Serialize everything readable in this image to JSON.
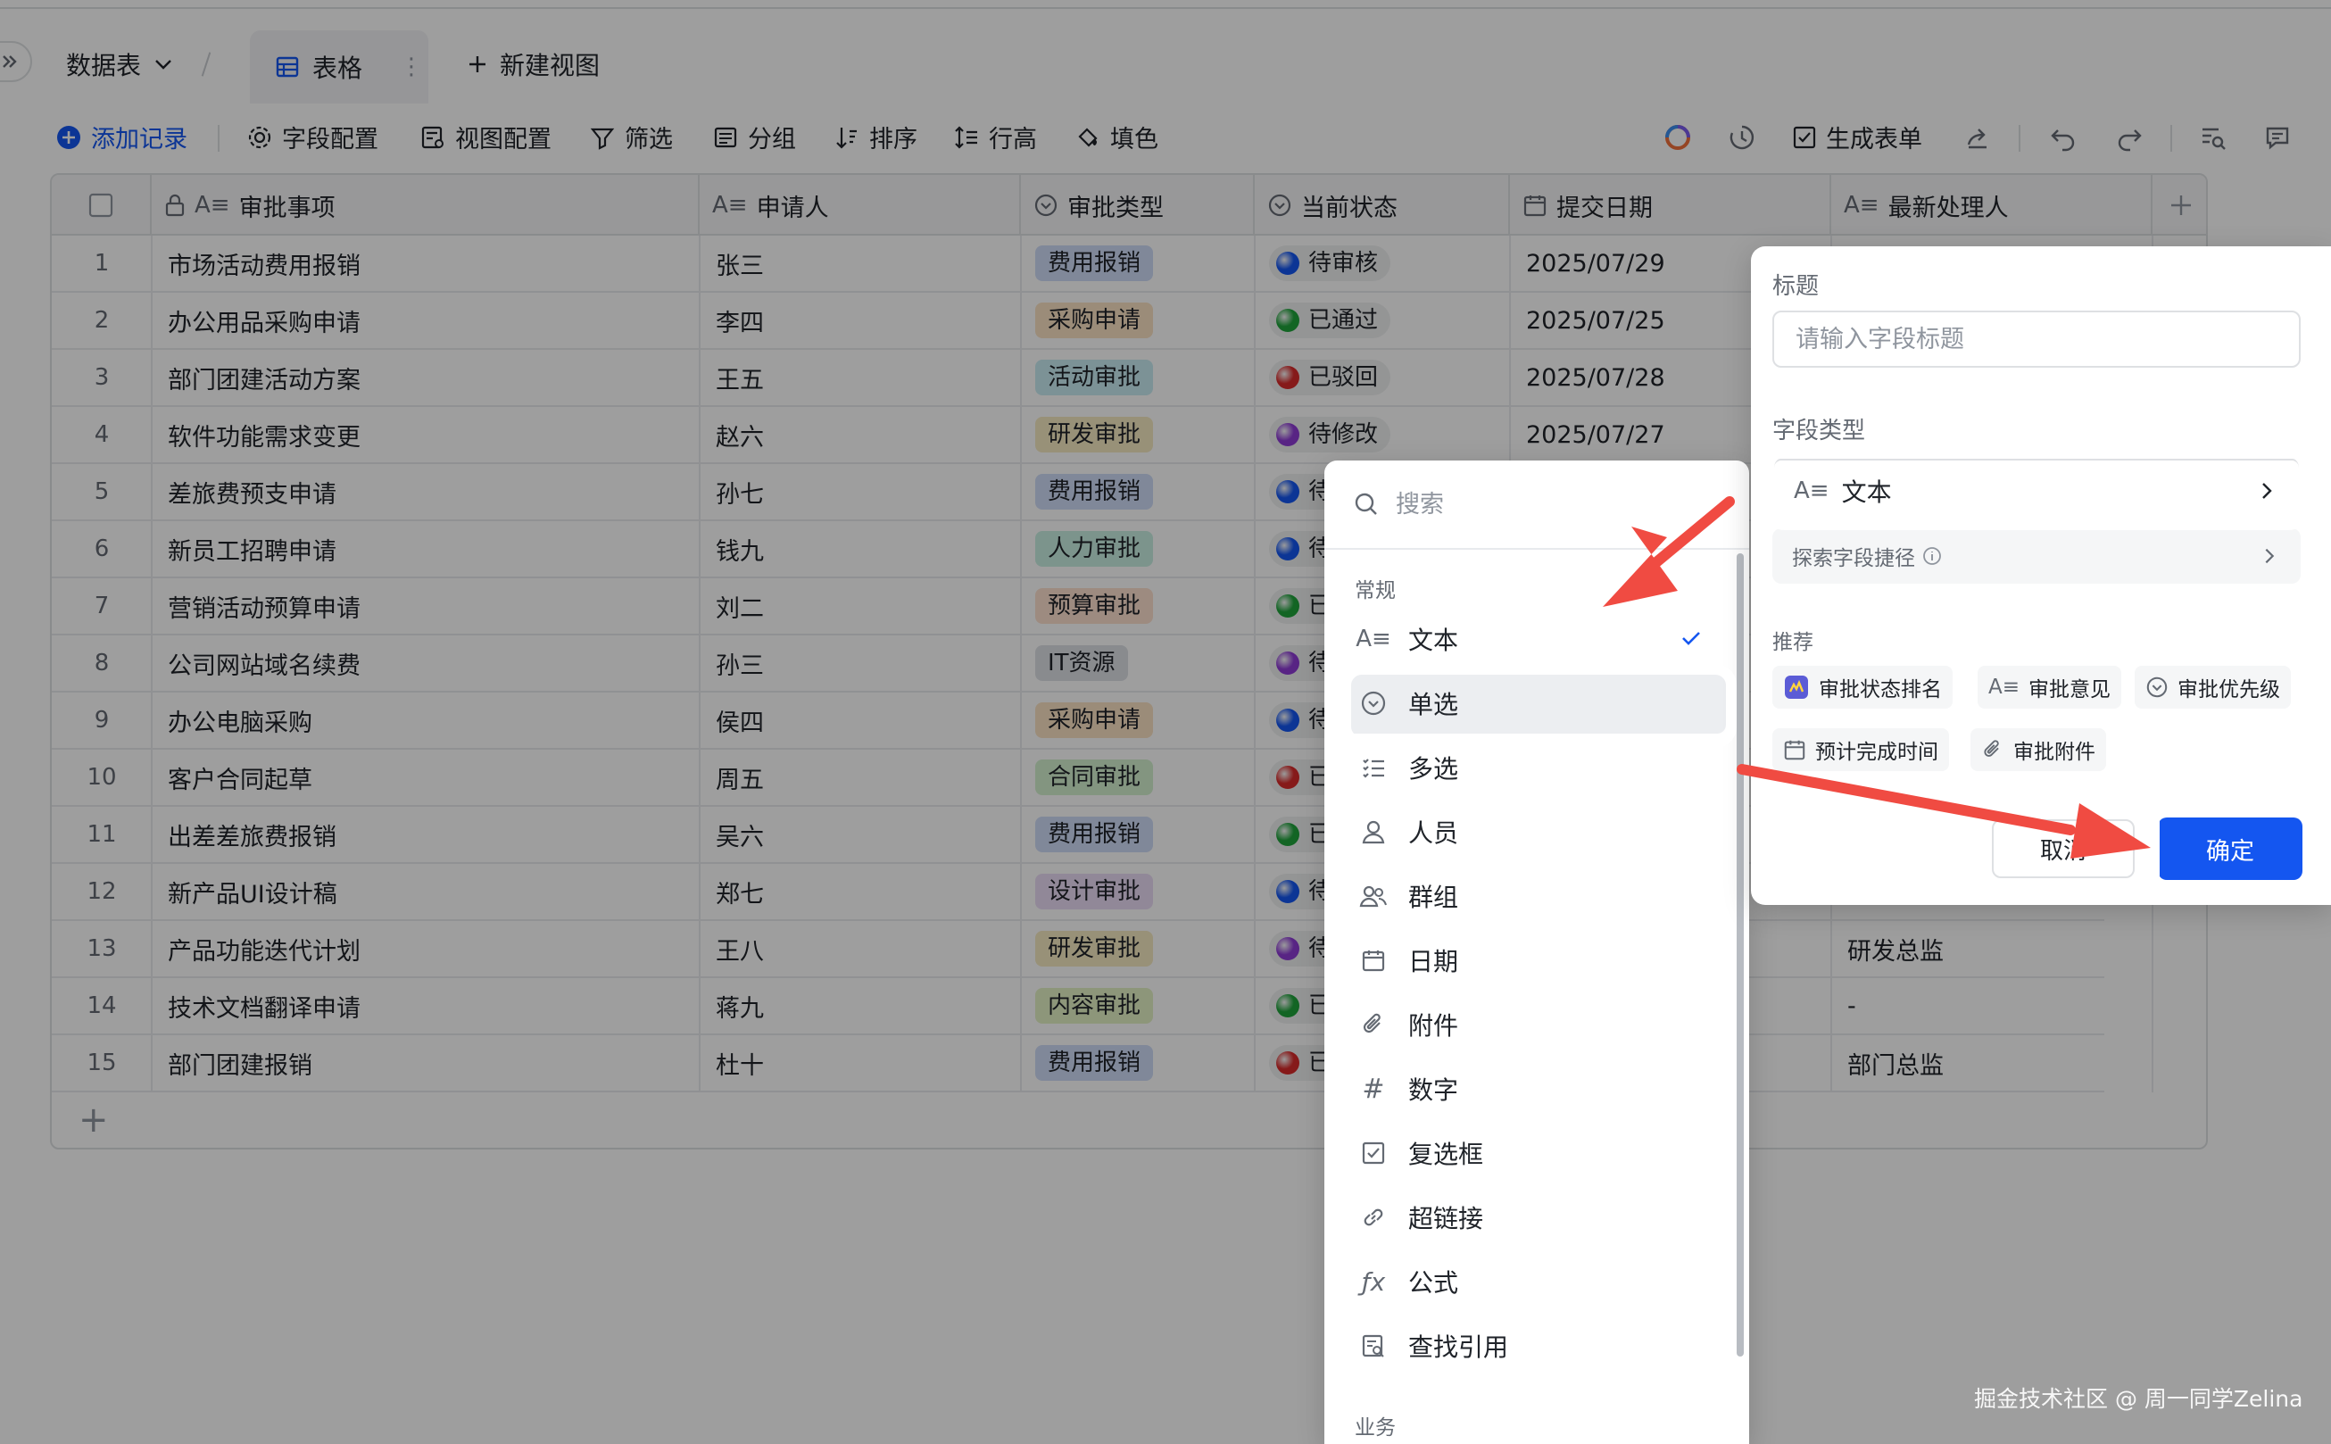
{
  "breadcrumb": {
    "table_name": "数据表",
    "view_label": "表格",
    "new_view_label": "新建视图"
  },
  "toolbar": {
    "add_record": "添加记录",
    "field_config": "字段配置",
    "view_config": "视图配置",
    "filter": "筛选",
    "group": "分组",
    "sort": "排序",
    "row_height": "行高",
    "fill_color": "填色",
    "generate_form": "生成表单"
  },
  "columns": [
    "审批事项",
    "申请人",
    "审批类型",
    "当前状态",
    "提交日期",
    "最新处理人"
  ],
  "rows": [
    {
      "no": "1",
      "item": "市场活动费用报销",
      "applicant": "张三",
      "type": "费用报销",
      "status": "待审核",
      "date": "2025/07/29",
      "handler": ""
    },
    {
      "no": "2",
      "item": "办公用品采购申请",
      "applicant": "李四",
      "type": "采购申请",
      "status": "已通过",
      "date": "2025/07/25",
      "handler": ""
    },
    {
      "no": "3",
      "item": "部门团建活动方案",
      "applicant": "王五",
      "type": "活动审批",
      "status": "已驳回",
      "date": "2025/07/28",
      "handler": ""
    },
    {
      "no": "4",
      "item": "软件功能需求变更",
      "applicant": "赵六",
      "type": "研发审批",
      "status": "待修改",
      "date": "2025/07/27",
      "handler": ""
    },
    {
      "no": "5",
      "item": "差旅费预支申请",
      "applicant": "孙七",
      "type": "费用报销",
      "status": "待审",
      "date": "",
      "handler": ""
    },
    {
      "no": "6",
      "item": "新员工招聘申请",
      "applicant": "钱九",
      "type": "人力审批",
      "status": "待审",
      "date": "",
      "handler": ""
    },
    {
      "no": "7",
      "item": "营销活动预算申请",
      "applicant": "刘二",
      "type": "预算审批",
      "status": "已通",
      "date": "",
      "handler": ""
    },
    {
      "no": "8",
      "item": "公司网站域名续费",
      "applicant": "孙三",
      "type": "IT资源",
      "status": "待修",
      "date": "",
      "handler": ""
    },
    {
      "no": "9",
      "item": "办公电脑采购",
      "applicant": "侯四",
      "type": "采购申请",
      "status": "待审",
      "date": "",
      "handler": ""
    },
    {
      "no": "10",
      "item": "客户合同起草",
      "applicant": "周五",
      "type": "合同审批",
      "status": "已驳",
      "date": "",
      "handler": ""
    },
    {
      "no": "11",
      "item": "出差差旅费报销",
      "applicant": "吴六",
      "type": "费用报销",
      "status": "已通",
      "date": "",
      "handler": ""
    },
    {
      "no": "12",
      "item": "新产品UI设计稿",
      "applicant": "郑七",
      "type": "设计审批",
      "status": "待审",
      "date": "",
      "handler": ""
    },
    {
      "no": "13",
      "item": "产品功能迭代计划",
      "applicant": "王八",
      "type": "研发审批",
      "status": "待修",
      "date": "",
      "handler": "研发总监"
    },
    {
      "no": "14",
      "item": "技术文档翻译申请",
      "applicant": "蒋九",
      "type": "内容审批",
      "status": "已通",
      "date": "",
      "handler": "-"
    },
    {
      "no": "15",
      "item": "部门团建报销",
      "applicant": "杜十",
      "type": "费用报销",
      "status": "已驳",
      "date": "",
      "handler": "部门总监"
    }
  ],
  "type_colors": {
    "费用报销": "#cfdcf7",
    "采购申请": "#fbe2c4",
    "活动审批": "#c9ecf2",
    "研发审批": "#f6eac2",
    "人力审批": "#c9efe3",
    "预算审批": "#fde1cf",
    "IT资源": "#dde0e6",
    "合同审批": "#d3f1cf",
    "设计审批": "#ebdcf6",
    "内容审批": "#e4f2c6"
  },
  "status_colors": {
    "pending_review": "#1456f0",
    "approved": "#1fa33b",
    "rejected": "#d92b2b",
    "to_modify": "#8e3bd6"
  },
  "dropdown": {
    "search_placeholder": "搜索",
    "group_common": "常规",
    "group_business": "业务",
    "items": [
      "文本",
      "单选",
      "多选",
      "人员",
      "群组",
      "日期",
      "附件",
      "数字",
      "复选框",
      "超链接",
      "公式",
      "查找引用"
    ]
  },
  "panel": {
    "title_label": "标题",
    "title_placeholder": "请输入字段标题",
    "field_type_label": "字段类型",
    "field_type_value": "文本",
    "explore_shortcut": "探索字段捷径",
    "recommend_label": "推荐",
    "recommendations": [
      "审批状态排名",
      "审批意见",
      "审批优先级",
      "预计完成时间",
      "审批附件"
    ],
    "cancel": "取消",
    "confirm": "确定"
  },
  "watermark": "掘金技术社区 @ 周一同学Zelina",
  "accent_color": "#1456f0",
  "arrow_color": "#f04b42"
}
